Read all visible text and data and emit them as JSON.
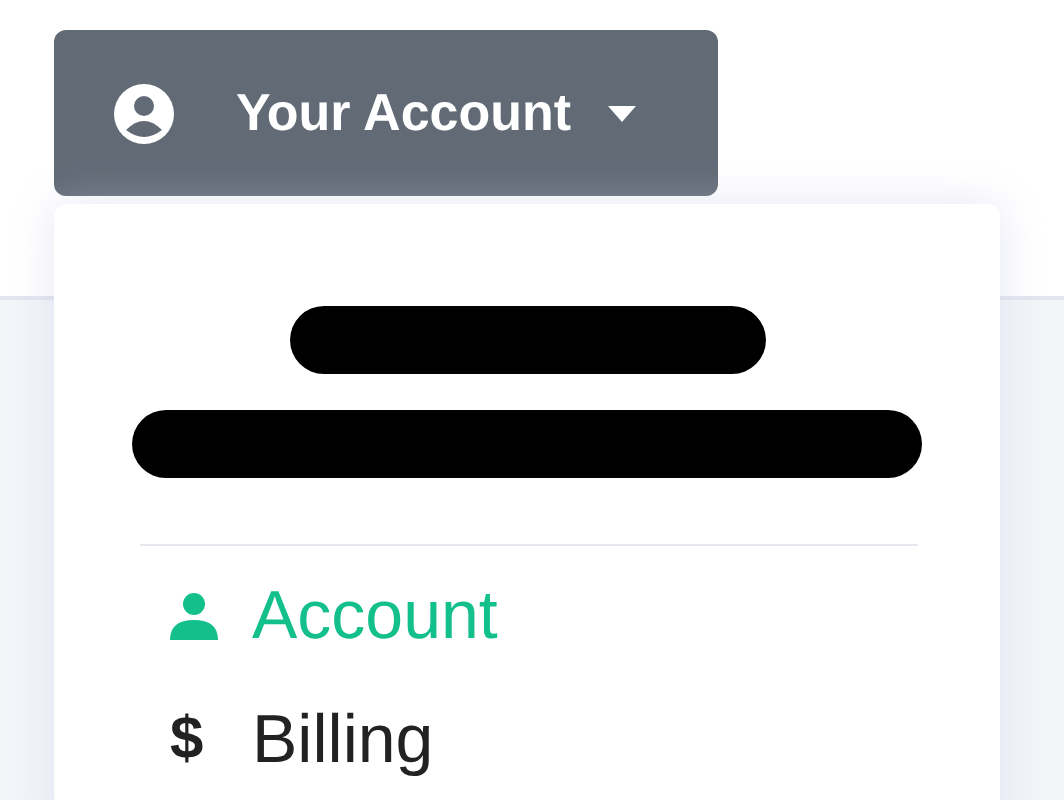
{
  "account_button": {
    "label": "Your Account"
  },
  "menu": {
    "redactions": [
      {
        "kind": "short"
      },
      {
        "kind": "long"
      }
    ],
    "items": [
      {
        "kind": "person",
        "label": "Account",
        "selected": true
      },
      {
        "kind": "glyph",
        "icon": "$",
        "label": "Billing",
        "selected": false
      }
    ]
  }
}
